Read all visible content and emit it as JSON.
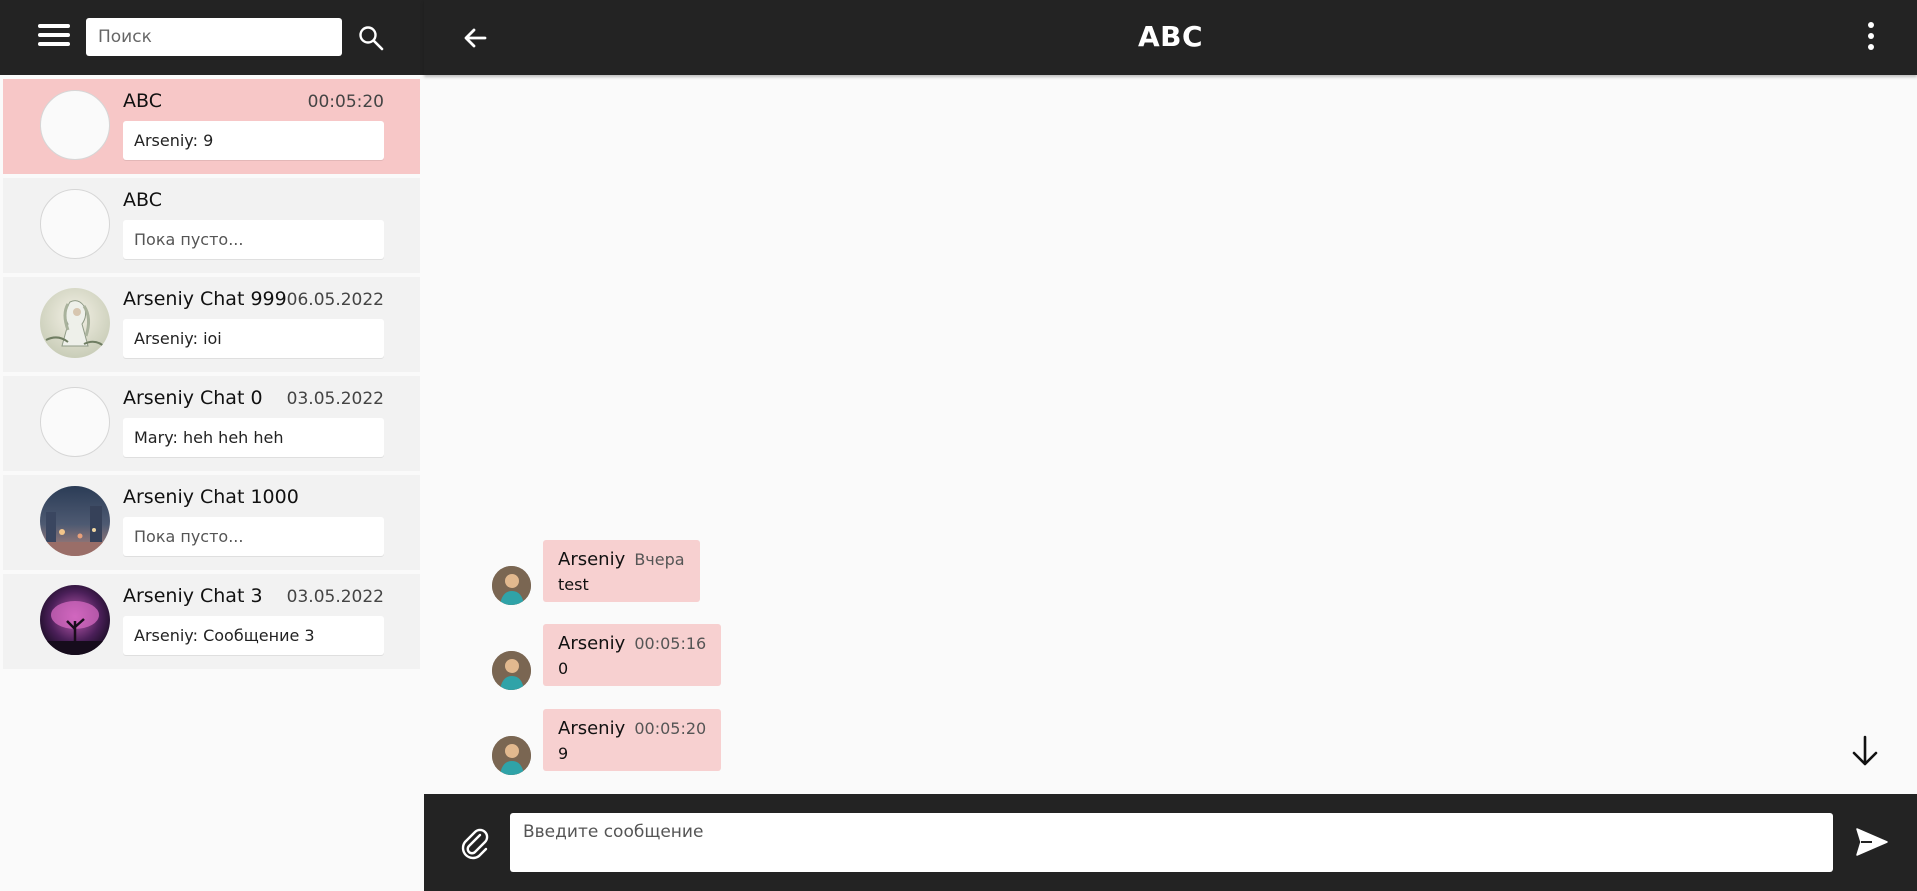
{
  "sidebar": {
    "search": {
      "placeholder": "Поиск",
      "value": ""
    },
    "chats": [
      {
        "title": "ABC",
        "time": "00:05:20",
        "preview": "Arseniy: 9",
        "active": true,
        "avatar": "empty"
      },
      {
        "title": "ABC",
        "time": "",
        "preview": "Пока пусто...",
        "active": false,
        "avatar": "empty"
      },
      {
        "title": "Arseniy Chat 999",
        "time": "06.05.2022",
        "preview": "Arseniy: ioi",
        "active": false,
        "avatar": "anime-girl"
      },
      {
        "title": "Arseniy Chat 0",
        "time": "03.05.2022",
        "preview": "Mary: heh heh heh",
        "active": false,
        "avatar": "empty"
      },
      {
        "title": "Arseniy Chat 1000",
        "time": "",
        "preview": "Пока пусто...",
        "active": false,
        "avatar": "city-night"
      },
      {
        "title": "Arseniy Chat 3",
        "time": "03.05.2022",
        "preview": "Arseniy: Сообщение 3",
        "active": false,
        "avatar": "purple-tree"
      }
    ]
  },
  "chat": {
    "title": "ABC",
    "messages": [
      {
        "author": "Arseniy",
        "time": "Вчера",
        "text": "test"
      },
      {
        "author": "Arseniy",
        "time": "00:05:16",
        "text": "0"
      },
      {
        "author": "Arseniy",
        "time": "00:05:20",
        "text": "9"
      }
    ],
    "composer": {
      "placeholder": "Введите сообщение",
      "value": ""
    }
  },
  "colors": {
    "header_bg": "#232323",
    "active_chat_bg": "#f7c7c7",
    "message_bubble_bg": "#f7d0d0",
    "chat_item_bg": "#f2f2f2"
  },
  "icons": {
    "menu": "hamburger-icon",
    "search": "search-icon",
    "back": "arrow-left-icon",
    "more": "more-vertical-icon",
    "scroll_down": "arrow-down-icon",
    "attach": "paperclip-icon",
    "send": "send-icon"
  }
}
